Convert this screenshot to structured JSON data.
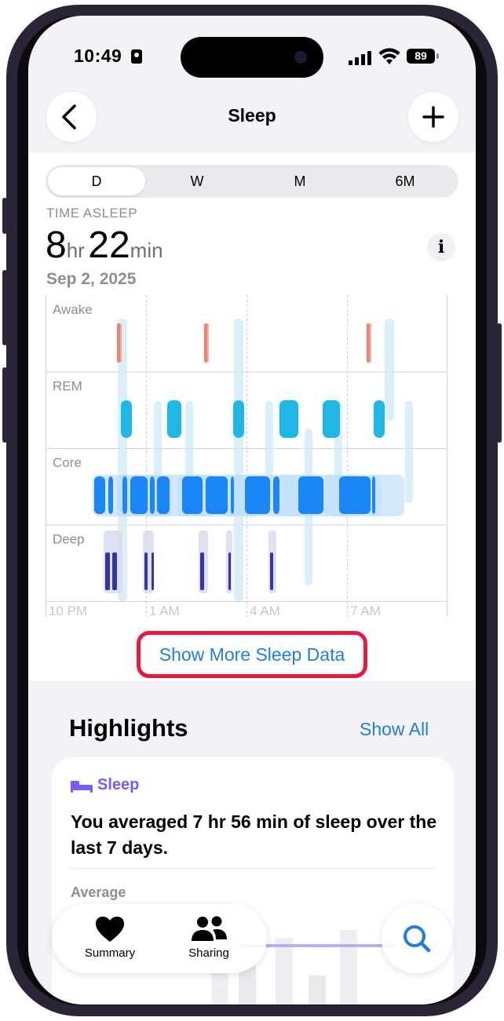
{
  "status": {
    "time": "10:49",
    "battery": "89"
  },
  "nav": {
    "title": "Sleep"
  },
  "segments": [
    "D",
    "W",
    "M",
    "6M"
  ],
  "summary": {
    "label": "TIME ASLEEP",
    "hours": "8",
    "hours_unit": "hr",
    "minutes": "22",
    "minutes_unit": "min",
    "date": "Sep 2, 2025"
  },
  "chart_data": {
    "type": "timeline",
    "stages": [
      "Awake",
      "REM",
      "Core",
      "Deep"
    ],
    "x_ticks": [
      "10 PM",
      "1 AM",
      "4 AM",
      "7 AM"
    ],
    "colors": {
      "awake": "#f4806e",
      "rem": "#1fb8e6",
      "core": "#1a86f5",
      "deep": "#3834a8"
    }
  },
  "show_more_label": "Show More Sleep Data",
  "highlights": {
    "title": "Highlights",
    "show_all": "Show All",
    "card": {
      "category": "Sleep",
      "text": "You averaged 7 hr 56 min of sleep over the last 7 days.",
      "average_label": "Average"
    }
  },
  "tabbar": {
    "summary": "Summary",
    "sharing": "Sharing"
  }
}
